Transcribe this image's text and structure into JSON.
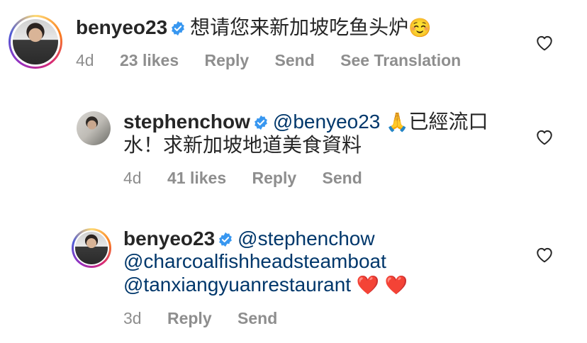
{
  "comments": [
    {
      "username": "benyeo23",
      "text": "想请您来新加坡吃鱼头炉",
      "emoji": "☺️",
      "time": "4d",
      "likes": "23 likes",
      "reply": "Reply",
      "send": "Send",
      "translate": "See Translation"
    },
    {
      "username": "stephenchow",
      "mention": "@benyeo23",
      "emoji": "🙏",
      "text_line1": "已經流口",
      "text_line2": "水！求新加坡地道美食資料",
      "time": "4d",
      "likes": "41 likes",
      "reply": "Reply",
      "send": "Send"
    },
    {
      "username": "benyeo23",
      "mention1": "@stephenchow",
      "mention2": "@charcoalfishheadsteamboat",
      "mention3": "@tanxiangyuanrestaurant",
      "emoji": "❤️ ❤️",
      "time": "3d",
      "reply": "Reply",
      "send": "Send"
    }
  ],
  "colors": {
    "verified": "#3897f0",
    "mention": "#00376b",
    "meta": "#8e8e8e"
  }
}
